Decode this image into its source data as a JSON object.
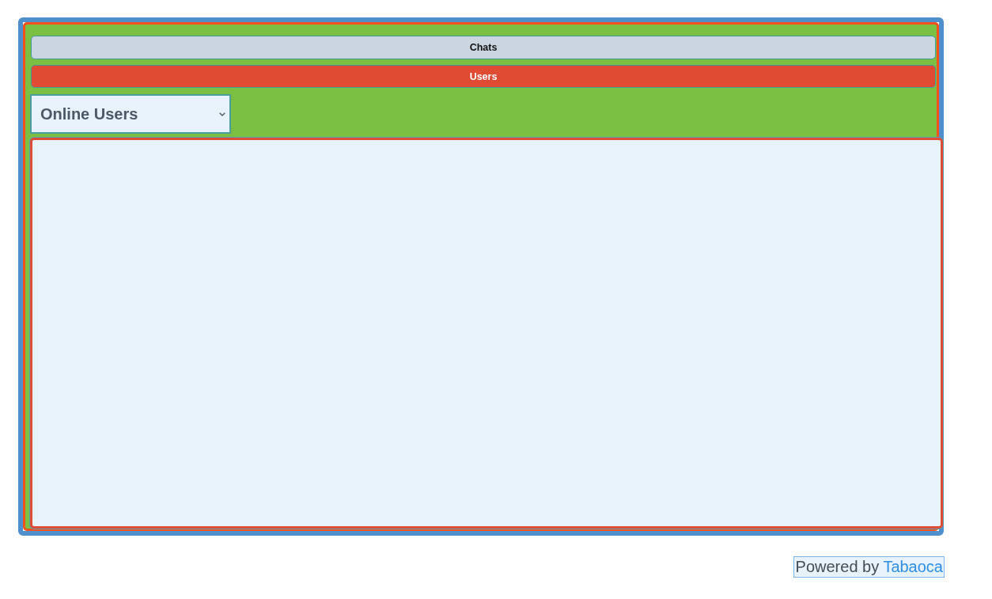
{
  "tabs": [
    {
      "label": "Chats",
      "selected": false
    },
    {
      "label": "Users",
      "selected": true
    }
  ],
  "filter": {
    "value": "Online Users"
  },
  "footer": {
    "text": "Powered by",
    "link": "Tabaoca"
  }
}
